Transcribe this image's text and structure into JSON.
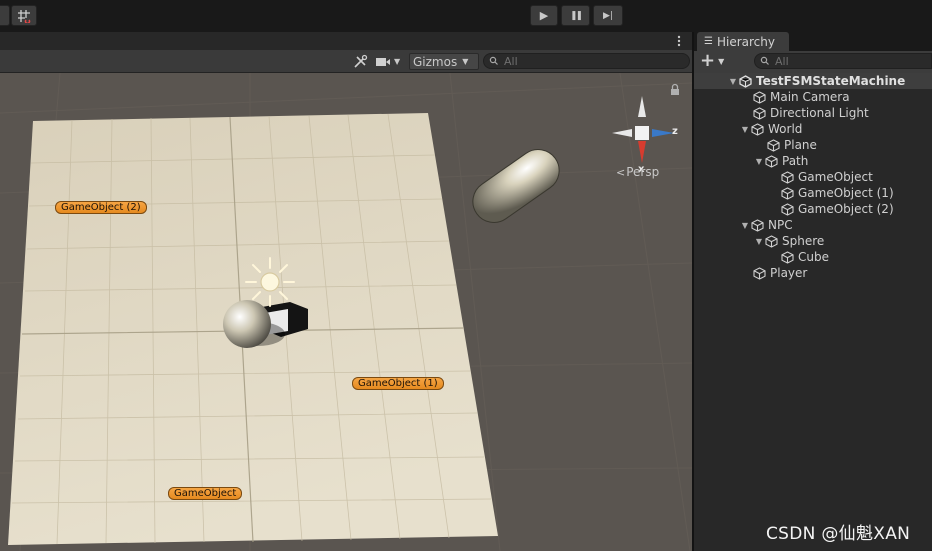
{
  "toolbar": {
    "play_label": "▶",
    "pause_label": "❚❚",
    "step_label": "▶|"
  },
  "scene_toolbar": {
    "gizmos_label": "Gizmos",
    "search_placeholder": "All"
  },
  "gizmo": {
    "x_label": "x",
    "z_label": "z",
    "persp_label": "Persp"
  },
  "scene_labels": {
    "go2": "GameObject (2)",
    "go1": "GameObject (1)",
    "go0": "GameObject"
  },
  "hierarchy": {
    "tab_label": "Hierarchy",
    "add_label": "+",
    "search_placeholder": "All",
    "items": [
      {
        "label": "TestFSMStateMachine"
      },
      {
        "label": "Main Camera"
      },
      {
        "label": "Directional Light"
      },
      {
        "label": "World"
      },
      {
        "label": "Plane"
      },
      {
        "label": "Path"
      },
      {
        "label": "GameObject"
      },
      {
        "label": "GameObject (1)"
      },
      {
        "label": "GameObject (2)"
      },
      {
        "label": "NPC"
      },
      {
        "label": "Sphere"
      },
      {
        "label": "Cube"
      },
      {
        "label": "Player"
      }
    ]
  },
  "watermark": "CSDN @仙魁XAN",
  "colors": {
    "accent_blue": "#3a79c8",
    "label_orange": "#f0962e",
    "panel_bg": "#282828"
  }
}
